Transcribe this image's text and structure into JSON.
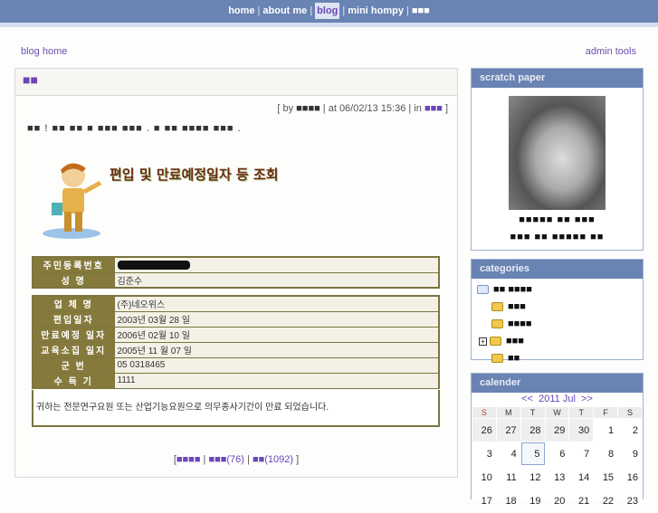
{
  "topnav": {
    "items": [
      "home",
      "about me",
      "blog",
      "mini hompy",
      "■■■"
    ],
    "active": "blog"
  },
  "sublinks": {
    "blog_home": "blog home",
    "admin_tools": "admin tools"
  },
  "post": {
    "title": "■■",
    "meta_by_label": "[ by",
    "author": "■■■■",
    "meta_at": "| at 06/02/13 15:36 | in",
    "category": "■■■",
    "meta_end": "]",
    "lead": "■■ ! ■■ ■■ ■ ■■■ ■■■ . ■ ■■ ■■■■ ■■■ .",
    "image_headline": "편입 및 만료예정일자 등 조회",
    "table1": [
      {
        "label": "주민등록번호",
        "value": ""
      },
      {
        "label": "성  명",
        "value": "김준수"
      }
    ],
    "table2": [
      {
        "label": "업 체 명",
        "value": "(주)네오위스"
      },
      {
        "label": "편입일자",
        "value": "2003년 03월 28 일"
      },
      {
        "label": "만료예정 일자",
        "value": "2006년 02월 10 일"
      },
      {
        "label": "교육소집 일지",
        "value": "2005년 11 월 07 일"
      },
      {
        "label": "군  번",
        "value": "05 0318465"
      },
      {
        "label": "수 득 기",
        "value": "1111"
      }
    ],
    "message": "귀하는 전문연구요원 또는 산업기능요원으로 의무종사기간이 만료 되었습니다.",
    "footer": {
      "link1": "■■■■",
      "link2": "■■■",
      "count2": "(76)",
      "link3": "■■",
      "count3": "(1092)"
    }
  },
  "sidebar": {
    "scratch": {
      "title": "scratch paper",
      "caption1": "■■■■■ ■■ ■■■",
      "caption2": "■■■ ■■ ■■■■■ ■■"
    },
    "categories": {
      "title": "categories",
      "root": "■■ ■■■■",
      "items": [
        "■■■",
        "■■■■",
        "■■■",
        "■■"
      ]
    },
    "calendar": {
      "title": "calender",
      "prev": "<<",
      "month": "2011 Jul",
      "next": ">>",
      "days": [
        "S",
        "M",
        "T",
        "W",
        "T",
        "F",
        "S"
      ],
      "weeks": [
        [
          "26",
          "27",
          "28",
          "29",
          "30",
          "1",
          "2"
        ],
        [
          "3",
          "4",
          "5",
          "6",
          "7",
          "8",
          "9"
        ],
        [
          "10",
          "11",
          "12",
          "13",
          "14",
          "15",
          "16"
        ],
        [
          "17",
          "18",
          "19",
          "20",
          "21",
          "22",
          "23"
        ]
      ],
      "today": "5"
    }
  },
  "colors": {
    "nav": "#6983b3",
    "accent": "#6a47b8",
    "table_label": "#857a3b"
  }
}
